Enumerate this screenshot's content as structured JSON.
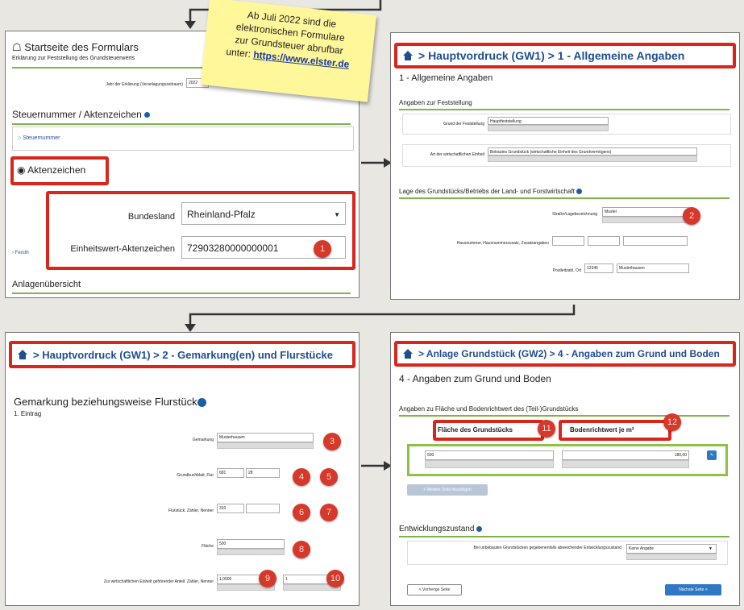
{
  "sticky": {
    "lines": [
      "Ab Juli 2022 sind die",
      "elektronischen Formulare",
      "zur Grundsteuer abrufbar"
    ],
    "prefix": "unter: ",
    "url": "https://www.elster.de"
  },
  "p1": {
    "title": "Startseite des Formulars",
    "subtitle": "Erklärung zur Feststellung des Grundsteuerwerts",
    "year_label": "Jahr der Erklärung (Veranlagungszeitraum)",
    "year_value": "2022",
    "section": "Steuernummer / Aktenzeichen",
    "radio_steuernummer": "Steuernummer",
    "radio_aktenzeichen": "Aktenzeichen",
    "bundesland_label": "Bundesland",
    "bundesland_value": "Rheinland-Pfalz",
    "ewaz_label": "Einheitswert-Aktenzeichen",
    "ewaz_value": "72903280000000001",
    "link": "Fersth",
    "section2": "Anlagenübersicht",
    "marker": "1"
  },
  "p2": {
    "header": "> Hauptvordruck (GW1) > 1 - Allgemeine Angaben",
    "title": "1 - Allgemeine Angaben",
    "section1": "Angaben zur Feststellung",
    "grund_label": "Grund der Feststellung",
    "grund_value": "Hauptfeststellung",
    "art_label": "Art der wirtschaftlichen Einheit",
    "art_value": "Bebautes Grundstück (wirtschaftliche Einheit des Grundvermögens)",
    "section2": "Lage des Grundstücks/Betriebs der Land- und Forstwirtschaft",
    "strasse_label": "Straße/Lagebezeichnung",
    "strasse_value": "Muster",
    "hausnr_label": "Hausnummer, Hausnummerzusatz, Zusatzangaben",
    "plz_label": "Postleitzahl, Ort",
    "plz_value": "12345",
    "ort_value": "Musterhausen",
    "marker": "2"
  },
  "p3": {
    "header": "> Hauptvordruck (GW1) > 2 - Gemarkung(en) und Flurstücke",
    "title": "Gemarkung beziehungsweise Flurstück",
    "entry": "1. Eintrag",
    "gemarkung_label": "Gemarkung",
    "gemarkung_value": "Musterhausen",
    "grundbuch_label": "Grundbuchblatt, Flur",
    "grundbuch_value": "681",
    "flur_value": "28",
    "flurstueck_label": "Flurstück: Zähler, Nenner",
    "zaehler_value": "310",
    "flaeche_label": "Fläche",
    "flaeche_value": "500",
    "anteil_label": "Zur wirtschaftlichen Einheit gehörender Anteil: Zähler, Nenner",
    "anteil_z_value": "1,0000",
    "anteil_n_value": "1",
    "markers": [
      "3",
      "4",
      "5",
      "6",
      "7",
      "8",
      "9",
      "10"
    ]
  },
  "p4": {
    "header": "> Anlage Grundstück (GW2) > 4 - Angaben zum Grund und Boden",
    "title": "4 - Angaben zum Grund und Boden",
    "subtitle": "Angaben zu Fläche und Bodenrichtwert des (Teil-)Grundstücks",
    "col1": "Fläche des Grundstücks",
    "col2": "Bodenrichtwert je m²",
    "flaeche_value": "500",
    "brw_value": "180,00",
    "add_button": "+ Weitere Zeile hinzufügen",
    "section2": "Entwicklungszustand",
    "entw_label": "Bei unbebauten Grundstücken gegebenenfalls abweichender Entwicklungszustand",
    "entw_value": "Keine Angabe",
    "prev_button": "< Vorherige Seite",
    "next_button": "Nächste Seite >",
    "markers": [
      "11",
      "12"
    ]
  },
  "colors": {
    "accent_red": "#d9261c",
    "link_blue": "#1d4e91",
    "green": "#7fb44a",
    "sticky": "#fff79a"
  }
}
